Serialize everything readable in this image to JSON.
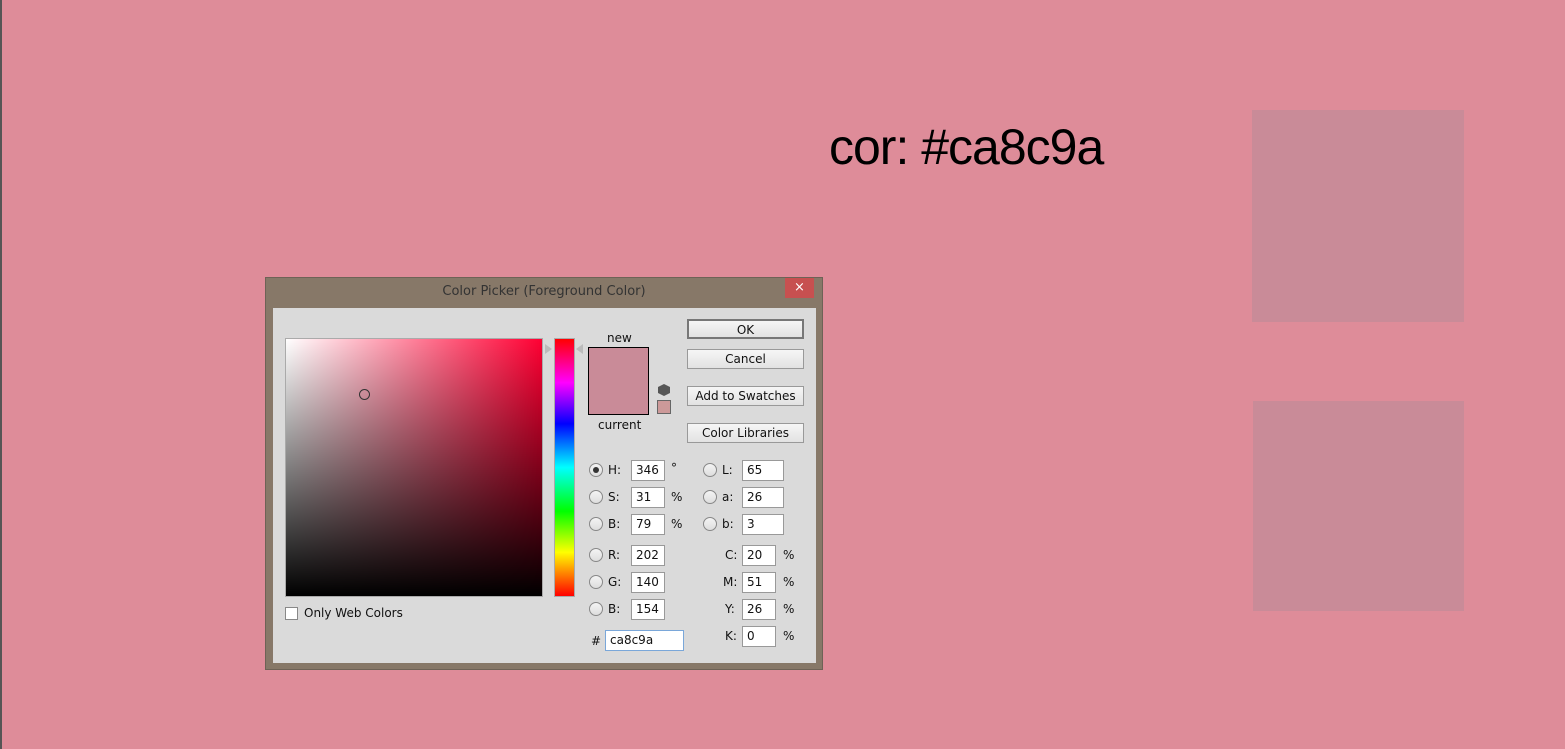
{
  "heading": "cor: #ca8c9a",
  "dialog": {
    "title": "Color Picker (Foreground Color)",
    "close": "×",
    "new_label": "new",
    "current_label": "current",
    "only_web_colors": "Only Web Colors",
    "buttons": {
      "ok": "OK",
      "cancel": "Cancel",
      "add_swatches": "Add to Swatches",
      "libraries": "Color Libraries"
    },
    "selected_color": "#ca8c9a",
    "fields": {
      "H": {
        "label": "H:",
        "value": "346",
        "unit": "°"
      },
      "S": {
        "label": "S:",
        "value": "31",
        "unit": "%"
      },
      "Bri": {
        "label": "B:",
        "value": "79",
        "unit": "%"
      },
      "R": {
        "label": "R:",
        "value": "202"
      },
      "G": {
        "label": "G:",
        "value": "140"
      },
      "Blue": {
        "label": "B:",
        "value": "154"
      },
      "L": {
        "label": "L:",
        "value": "65"
      },
      "a": {
        "label": "a:",
        "value": "26"
      },
      "b": {
        "label": "b:",
        "value": "3"
      },
      "C": {
        "label": "C:",
        "value": "20",
        "unit": "%"
      },
      "M": {
        "label": "M:",
        "value": "51",
        "unit": "%"
      },
      "Y": {
        "label": "Y:",
        "value": "26",
        "unit": "%"
      },
      "K": {
        "label": "K:",
        "value": "0",
        "unit": "%"
      },
      "hex": {
        "label": "#",
        "value": "ca8c9a"
      }
    }
  }
}
